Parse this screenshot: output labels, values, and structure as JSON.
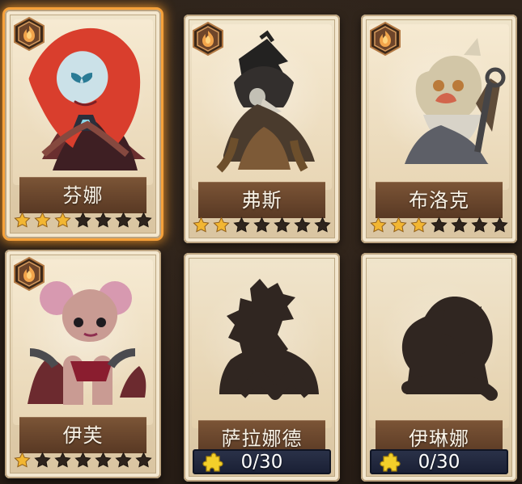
{
  "collection": {
    "cards": [
      {
        "name": "芬娜",
        "selected": true,
        "unlocked": true,
        "stars": 3,
        "max_stars": 7,
        "emblem_icon": "flame-emblem-icon",
        "portrait_icon": "fenna-portrait-icon"
      },
      {
        "name": "弗斯",
        "selected": false,
        "unlocked": true,
        "stars": 2,
        "max_stars": 7,
        "emblem_icon": "flame-emblem-icon",
        "portrait_icon": "vos-portrait-icon"
      },
      {
        "name": "布洛克",
        "selected": false,
        "unlocked": true,
        "stars": 3,
        "max_stars": 7,
        "emblem_icon": "flame-emblem-icon",
        "portrait_icon": "brock-portrait-icon"
      },
      {
        "name": "伊芙",
        "selected": false,
        "unlocked": true,
        "stars": 1,
        "max_stars": 7,
        "emblem_icon": "flame-emblem-icon",
        "portrait_icon": "eve-portrait-icon"
      },
      {
        "name": "萨拉娜德",
        "selected": false,
        "unlocked": false,
        "progress_text": "0/30",
        "progress_value": 0,
        "progress_max": 30,
        "portrait_icon": "silhouette-icon",
        "puzzle_icon": "puzzle-icon"
      },
      {
        "name": "伊琳娜",
        "selected": false,
        "unlocked": false,
        "progress_text": "0/30",
        "progress_value": 0,
        "progress_max": 30,
        "portrait_icon": "silhouette-icon",
        "puzzle_icon": "puzzle-icon"
      }
    ]
  },
  "colors": {
    "selected_glow": "#f6a13a",
    "star_active": "#f2b632",
    "star_inactive": "#2e241d",
    "progress_bar": "#1f2640",
    "card_paper": "#eadcbf",
    "name_plate": "#6e4a31"
  }
}
